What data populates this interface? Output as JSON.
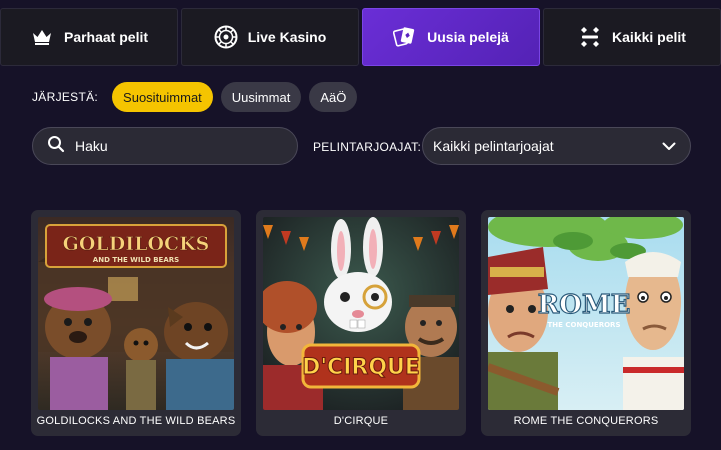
{
  "tabs": [
    {
      "label": "Parhaat pelit",
      "icon": "crown-icon",
      "active": false
    },
    {
      "label": "Live Kasino",
      "icon": "roulette-wheel-icon",
      "active": false
    },
    {
      "label": "Uusia pelejä",
      "icon": "playing-cards-icon",
      "active": true
    },
    {
      "label": "Kaikki pelit",
      "icon": "dice-icon",
      "active": false
    }
  ],
  "sort": {
    "label": "JÄRJESTÄ:",
    "options": [
      "Suosituimmat",
      "Uusimmat",
      "AäÖ"
    ],
    "selected": "Suosituimmat"
  },
  "search": {
    "placeholder": "Haku",
    "value": ""
  },
  "providers": {
    "label": "PELINTARJOAJAT:",
    "selected": "Kaikki pelintarjoajat"
  },
  "games": [
    {
      "title": "GOLDILOCKS AND THE WILD BEARS",
      "logo_main": "GOLDILOCKS",
      "logo_sub": "AND THE WILD BEARS"
    },
    {
      "title": "D'CIRQUE",
      "logo_main": "D'CIRQUE"
    },
    {
      "title": "ROME THE CONQUERORS",
      "logo_main": "ROME",
      "logo_sub": "THE CONQUERORS"
    }
  ],
  "colors": {
    "background": "#161228",
    "tab": "#1b1a22",
    "tab_active": "#6a2ed6",
    "pill": "#3a3946",
    "pill_active": "#f5c400",
    "card": "#2c2b36"
  }
}
